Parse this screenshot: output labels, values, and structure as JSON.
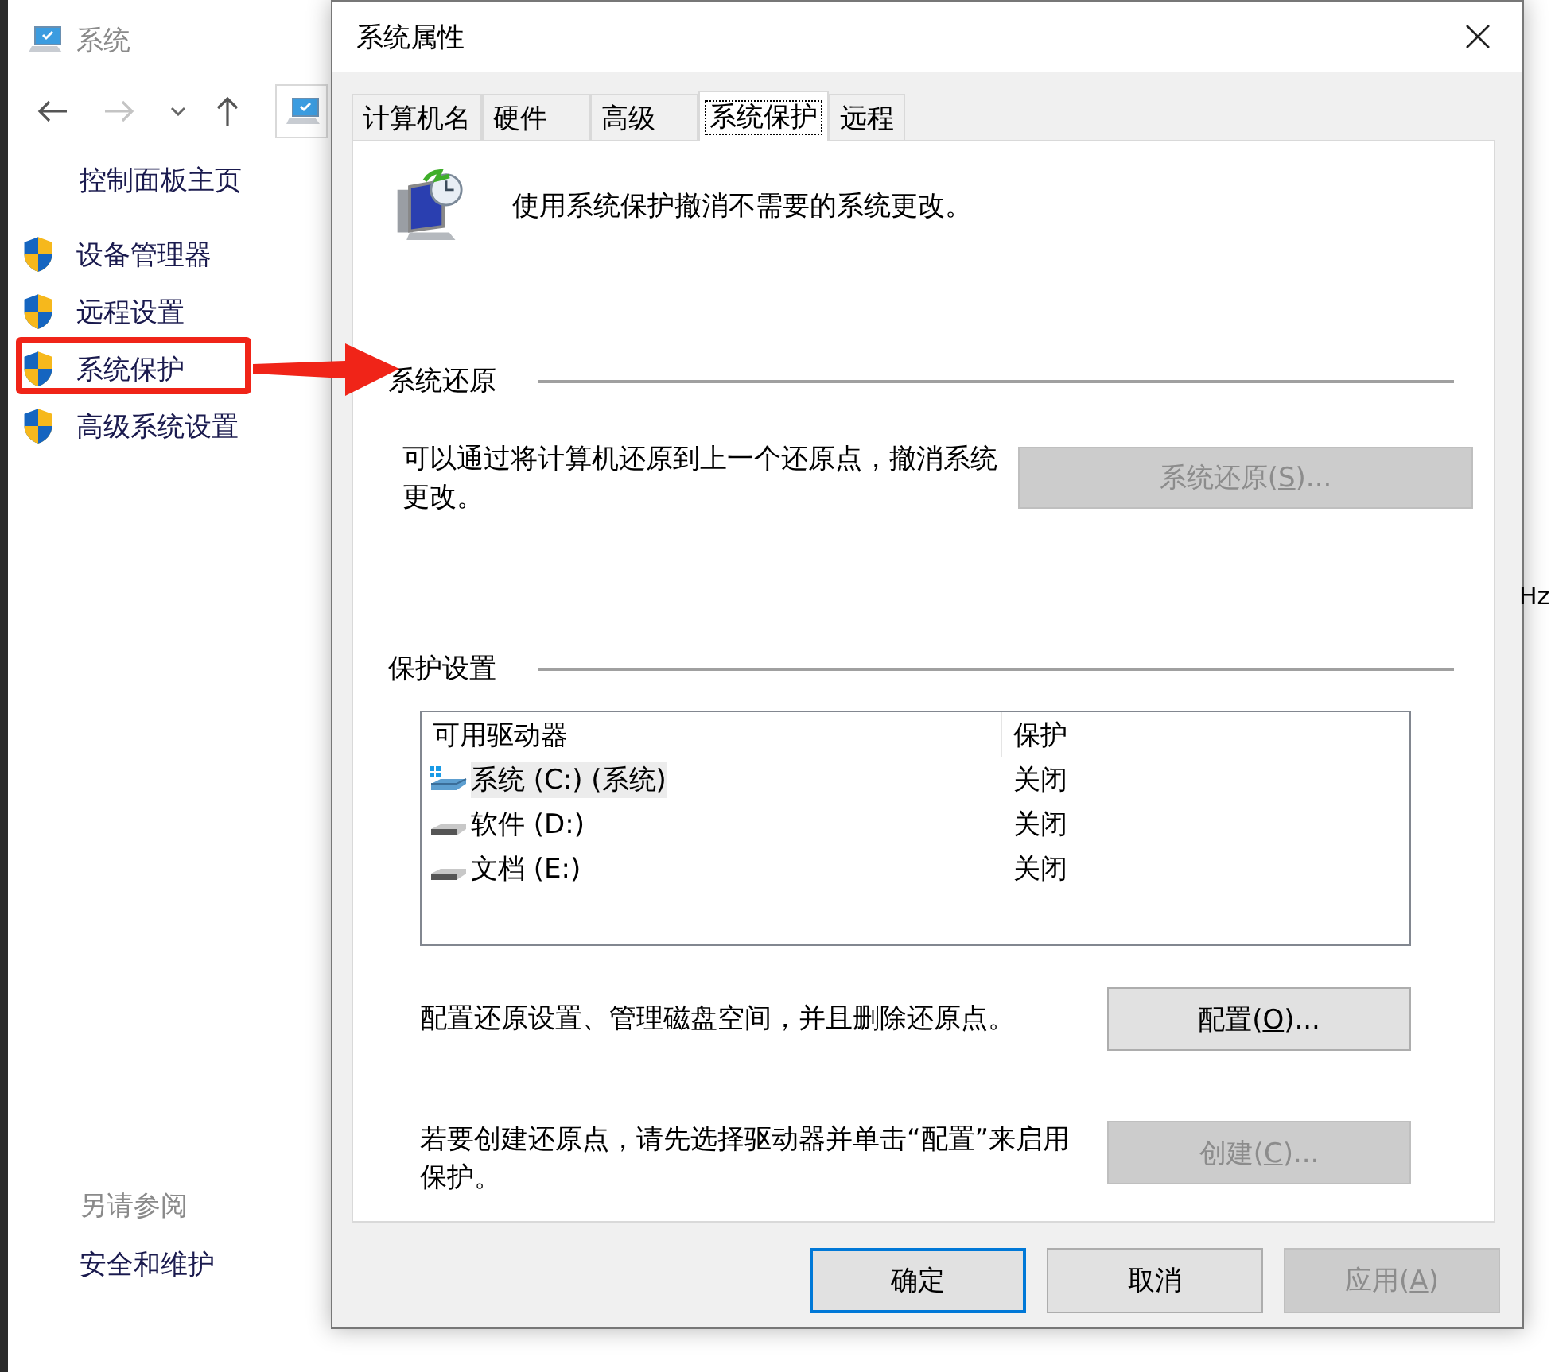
{
  "background_window": {
    "title": "系统",
    "nav_home": "控制面板主页",
    "nav_items": [
      {
        "label": "设备管理器",
        "annotated": false
      },
      {
        "label": "远程设置",
        "annotated": false
      },
      {
        "label": "系统保护",
        "annotated": true
      },
      {
        "label": "高级系统设置",
        "annotated": false
      }
    ],
    "see_also_heading": "另请参阅",
    "see_also_links": [
      "安全和维护"
    ],
    "edge_fragment": "Hz"
  },
  "dialog": {
    "title": "系统属性",
    "tabs": [
      {
        "label": "计算机名",
        "selected": false
      },
      {
        "label": "硬件",
        "selected": false
      },
      {
        "label": "高级",
        "selected": false
      },
      {
        "label": "系统保护",
        "selected": true
      },
      {
        "label": "远程",
        "selected": false
      }
    ],
    "intro": "使用系统保护撤消不需要的系统更改。",
    "restore": {
      "heading": "系统还原",
      "description": "可以通过将计算机还原到上一个还原点，撤消系统更改。",
      "button": {
        "label": "系统还原(",
        "access_key": "S",
        "label_after": ")...",
        "disabled": true
      }
    },
    "protection": {
      "heading": "保护设置",
      "columns": [
        "可用驱动器",
        "保护"
      ],
      "drives": [
        {
          "name": "系统 (C:) (系统)",
          "kind": "system",
          "protection": "关闭",
          "selected": true
        },
        {
          "name": "软件 (D:)",
          "kind": "data",
          "protection": "关闭",
          "selected": false
        },
        {
          "name": "文档 (E:)",
          "kind": "data",
          "protection": "关闭",
          "selected": false
        }
      ],
      "configure": {
        "description": "配置还原设置、管理磁盘空间，并且删除还原点。",
        "button": {
          "label": "配置(",
          "access_key": "O",
          "label_after": ")...",
          "disabled": false
        }
      },
      "create": {
        "description": "若要创建还原点，请先选择驱动器并单击“配置”来启用保护。",
        "button": {
          "label": "创建(",
          "access_key": "C",
          "label_after": ")...",
          "disabled": true
        }
      }
    },
    "buttons": [
      {
        "label": "确定",
        "default": true,
        "disabled": false
      },
      {
        "label": "取消",
        "default": false,
        "disabled": false
      },
      {
        "label": "应用(",
        "access_key": "A",
        "label_after": ")",
        "default": false,
        "disabled": true
      }
    ]
  }
}
